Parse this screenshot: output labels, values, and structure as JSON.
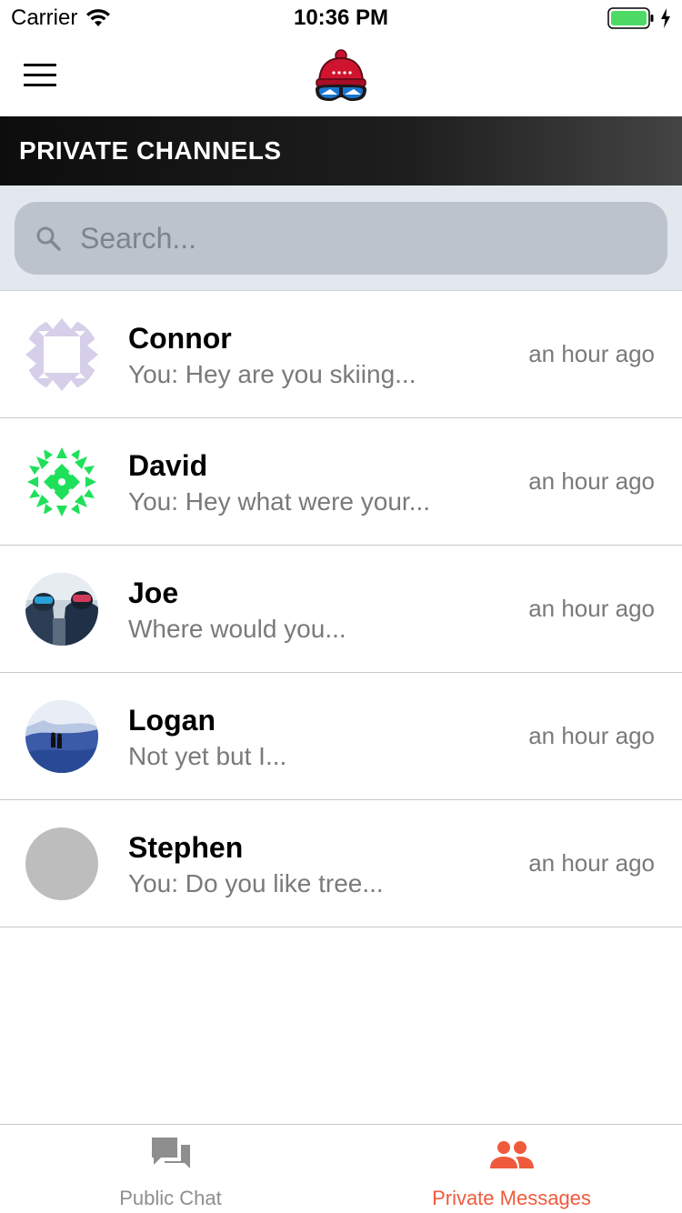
{
  "status_bar": {
    "carrier": "Carrier",
    "time": "10:36 PM",
    "battery_color": "#4cd964"
  },
  "nav": {
    "menu_icon": "hamburger-menu-icon",
    "logo_icon": "ski-hat-goggles-logo"
  },
  "section": {
    "title": "PRIVATE CHANNELS"
  },
  "search": {
    "placeholder": "Search..."
  },
  "channels": [
    {
      "name": "Connor",
      "preview": "You: Hey are you skiing...",
      "time": "an hour ago",
      "avatar": "identicon-purple"
    },
    {
      "name": "David",
      "preview": "You: Hey what were your...",
      "time": "an hour ago",
      "avatar": "identicon-green"
    },
    {
      "name": "Joe",
      "preview": "Where would you...",
      "time": "an hour ago",
      "avatar": "photo-skiers-selfie"
    },
    {
      "name": "Logan",
      "preview": "Not yet but I...",
      "time": "an hour ago",
      "avatar": "photo-snowy-mountain"
    },
    {
      "name": "Stephen",
      "preview": "You: Do you like tree...",
      "time": "an hour ago",
      "avatar": "placeholder-gray"
    }
  ],
  "tabs": [
    {
      "label": "Public Chat",
      "icon": "chat-bubbles-icon",
      "active": false,
      "color": "#8e8e8e"
    },
    {
      "label": "Private Messages",
      "icon": "people-icon",
      "active": true,
      "color": "#f05a3c"
    }
  ]
}
